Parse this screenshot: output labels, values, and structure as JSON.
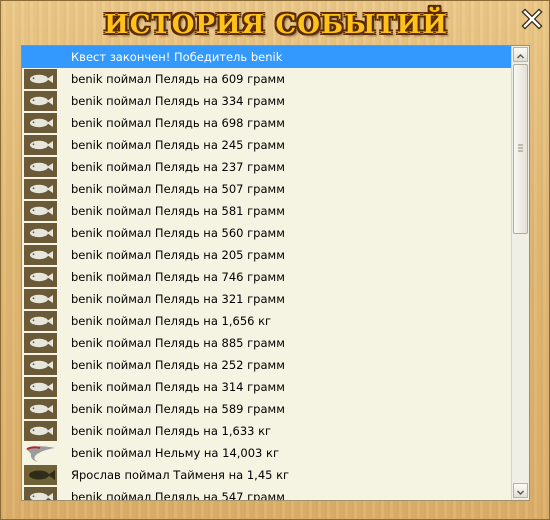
{
  "window": {
    "title": "ИСТОРИЯ СОБЫТИЙ",
    "close_icon": "close-x-icon"
  },
  "events": [
    {
      "icon": "none",
      "text": "Квест закончен! Победитель benik",
      "selected": true
    },
    {
      "icon": "fish-peled-icon",
      "text": "benik поймал Пелядь на 609 грамм"
    },
    {
      "icon": "fish-peled-icon",
      "text": "benik поймал Пелядь на 334 грамм"
    },
    {
      "icon": "fish-peled-icon",
      "text": "benik поймал Пелядь на 698 грамм"
    },
    {
      "icon": "fish-peled-icon",
      "text": "benik поймал Пелядь на 245 грамм"
    },
    {
      "icon": "fish-peled-icon",
      "text": "benik поймал Пелядь на 237 грамм"
    },
    {
      "icon": "fish-peled-icon",
      "text": "benik поймал Пелядь на 507 грамм"
    },
    {
      "icon": "fish-peled-icon",
      "text": "benik поймал Пелядь на 581 грамм"
    },
    {
      "icon": "fish-peled-icon",
      "text": "benik поймал Пелядь на 560 грамм"
    },
    {
      "icon": "fish-peled-icon",
      "text": "benik поймал Пелядь на 205 грамм"
    },
    {
      "icon": "fish-peled-icon",
      "text": "benik поймал Пелядь на 746 грамм"
    },
    {
      "icon": "fish-peled-icon",
      "text": "benik поймал Пелядь на 321 грамм"
    },
    {
      "icon": "fish-peled-icon",
      "text": "benik поймал Пелядь на 1,656 кг"
    },
    {
      "icon": "fish-peled-icon",
      "text": "benik поймал Пелядь на 885 грамм"
    },
    {
      "icon": "fish-peled-icon",
      "text": "benik поймал Пелядь на 252 грамм"
    },
    {
      "icon": "fish-peled-icon",
      "text": "benik поймал Пелядь на 314 грамм"
    },
    {
      "icon": "fish-peled-icon",
      "text": "benik поймал Пелядь на 589 грамм"
    },
    {
      "icon": "fish-peled-icon",
      "text": "benik поймал Пелядь на 1,633 кг"
    },
    {
      "icon": "fish-nelma-icon",
      "text": "benik поймал Нельму на 14,003 кг"
    },
    {
      "icon": "fish-taimen-icon",
      "text": "Ярослав поймал Тайменя на 1,45 кг"
    },
    {
      "icon": "fish-peled-icon",
      "text": "benik поймал Пелядь на 547 грамм"
    }
  ],
  "colors": {
    "selection": "#3399ff",
    "title": "#ffc21a",
    "list_background": "#f5f3e2"
  }
}
